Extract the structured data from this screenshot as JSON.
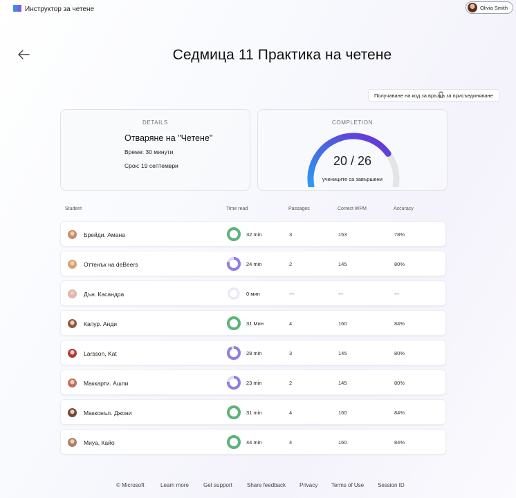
{
  "app": {
    "title": "Инструктор за четене",
    "user_name": "Olivia Smith"
  },
  "page": {
    "title": "Седмица 11 Практика на четене"
  },
  "actions": {
    "join_code_label": "Получаване на код за връзка за присъединяване"
  },
  "details": {
    "label": "DETAILS",
    "title": "Отваряне на \"Четене\"",
    "time": "Време: 30 минути",
    "due": "Срок: 19 септември"
  },
  "completion": {
    "label": "COMPLETION",
    "value": "20 / 26",
    "caption": "учениците са завършени",
    "completed": 20,
    "total": 26
  },
  "table": {
    "headers": {
      "student": "Student",
      "time_read": "Time read",
      "passages": "Passages",
      "wpm": "Correct WPM",
      "accuracy": "Accuracy"
    },
    "rows": [
      {
        "name": "Брейди. Амана",
        "time": "32 min",
        "progress": 1.0,
        "passages": "3",
        "wpm": "153",
        "accuracy": "78%"
      },
      {
        "name": "Оттенък на deBeers",
        "time": "24 min",
        "progress": 0.8,
        "passages": "2",
        "wpm": "145",
        "accuracy": "80%"
      },
      {
        "name": "Дън. Касандра",
        "time": "0 мин",
        "progress": 0.0,
        "passages": "---",
        "wpm": "---",
        "accuracy": "---"
      },
      {
        "name": "Капур. Анди",
        "time": "31 Мин",
        "progress": 1.0,
        "passages": "4",
        "wpm": "160",
        "accuracy": "84%"
      },
      {
        "name": "Larsson, Kat",
        "time": "28 min",
        "progress": 0.93,
        "passages": "3",
        "wpm": "145",
        "accuracy": "80%"
      },
      {
        "name": "Маккарти. Ашли",
        "time": "23 min",
        "progress": 0.77,
        "passages": "2",
        "wpm": "145",
        "accuracy": "80%"
      },
      {
        "name": "Макконъл. Джони",
        "time": "31 min",
        "progress": 1.0,
        "passages": "4",
        "wpm": "160",
        "accuracy": "84%"
      },
      {
        "name": "Миуа, Кайо",
        "time": "44 min",
        "progress": 1.0,
        "passages": "4",
        "wpm": "160",
        "accuracy": "84%"
      }
    ]
  },
  "footer": {
    "copyright": "© Microsoft",
    "learn_more": "Learn more",
    "support": "Get support",
    "feedback": "Share feedback",
    "privacy": "Privacy",
    "terms": "Terms of Use",
    "session": "Session ID"
  },
  "colors": {
    "complete_ring": "#5fb37a",
    "partial_ring": "#8f7fe0",
    "ring_track": "#dcd8f4",
    "gauge_start": "#2b9af3",
    "gauge_end": "#6b2fd1",
    "gauge_track": "#e4e4e4"
  }
}
